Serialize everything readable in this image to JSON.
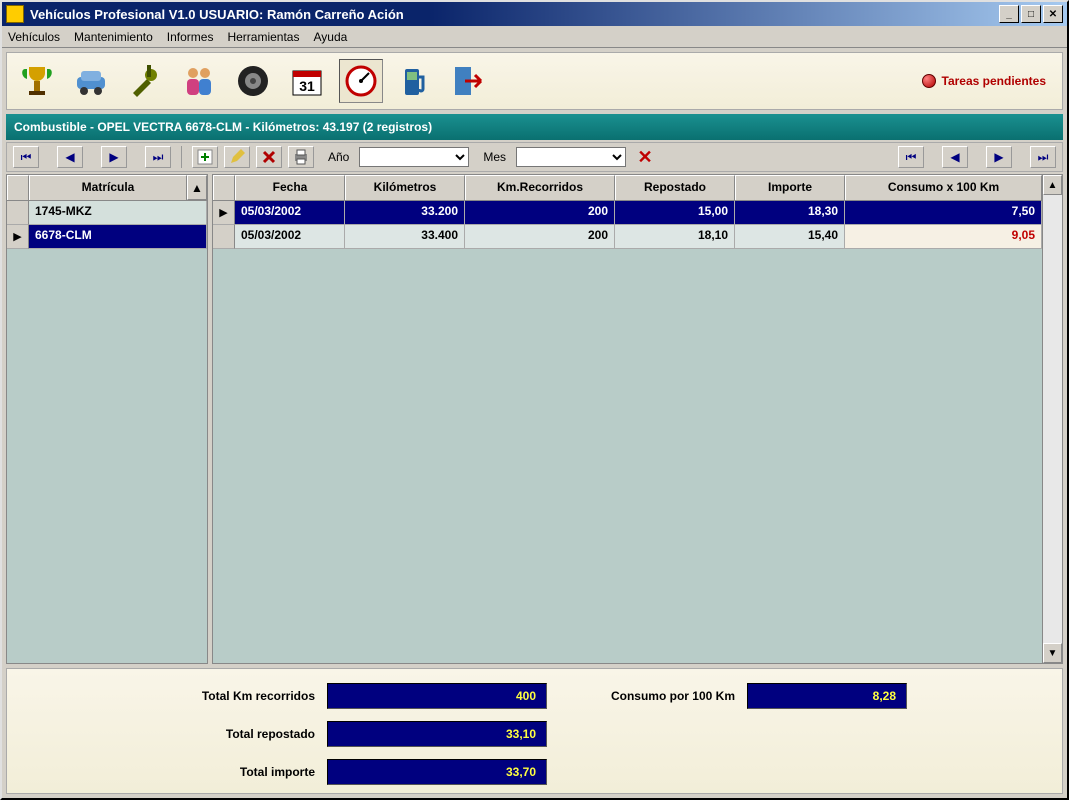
{
  "window": {
    "title": "Vehículos Profesional V1.0 USUARIO: Ramón Carreño Ación"
  },
  "menu": {
    "items": [
      "Vehículos",
      "Mantenimiento",
      "Informes",
      "Herramientas",
      "Ayuda"
    ]
  },
  "toolbar": {
    "icons": [
      "trophy",
      "car",
      "tools",
      "people",
      "tire",
      "calendar",
      "odometer",
      "fuel",
      "exit"
    ],
    "pending_label": "Tareas pendientes"
  },
  "section": {
    "title": "Combustible - OPEL VECTRA 6678-CLM  - Kilómetros: 43.197 (2 registros)"
  },
  "filters": {
    "year_label": "Año",
    "month_label": "Mes",
    "year_value": "",
    "month_value": ""
  },
  "left_grid": {
    "header": "Matrícula",
    "rows": [
      {
        "value": "1745-MKZ",
        "selected": false
      },
      {
        "value": "6678-CLM",
        "selected": true
      }
    ]
  },
  "data_grid": {
    "headers": [
      "Fecha",
      "Kilómetros",
      "Km.Recorridos",
      "Repostado",
      "Importe",
      "Consumo x 100 Km"
    ],
    "rows": [
      {
        "selected": true,
        "fecha": "05/03/2002",
        "km": "33.200",
        "recorridos": "200",
        "repostado": "15,00",
        "importe": "18,30",
        "consumo": "7,50",
        "warn": false
      },
      {
        "selected": false,
        "fecha": "05/03/2002",
        "km": "33.400",
        "recorridos": "200",
        "repostado": "18,10",
        "importe": "15,40",
        "consumo": "9,05",
        "warn": true
      }
    ]
  },
  "summary": {
    "total_km_label": "Total Km recorridos",
    "total_km_value": "400",
    "consumo_label": "Consumo  por 100 Km",
    "consumo_value": "8,28",
    "total_repostado_label": "Total repostado",
    "total_repostado_value": "33,10",
    "total_importe_label": "Total importe",
    "total_importe_value": "33,70"
  }
}
